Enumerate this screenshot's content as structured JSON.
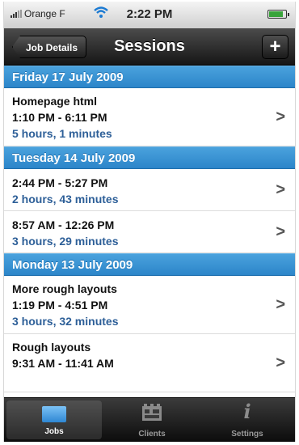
{
  "status_bar": {
    "carrier": "Orange F",
    "time": "2:22 PM"
  },
  "nav": {
    "back_label": "Job Details",
    "title": "Sessions",
    "add_label": "+"
  },
  "sections": [
    {
      "header": "Friday 17 July 2009",
      "rows": [
        {
          "title": "Homepage html",
          "times": "1:10 PM - 6:11 PM",
          "duration": "5 hours, 1 minutes"
        }
      ]
    },
    {
      "header": "Tuesday 14 July 2009",
      "rows": [
        {
          "times": "2:44 PM - 5:27 PM",
          "duration": "2 hours, 43 minutes"
        },
        {
          "times": "8:57 AM - 12:26 PM",
          "duration": "3 hours, 29 minutes"
        }
      ]
    },
    {
      "header": "Monday 13 July 2009",
      "rows": [
        {
          "title": "More rough layouts",
          "times": "1:19 PM - 4:51 PM",
          "duration": "3 hours, 32 minutes"
        },
        {
          "title": "Rough layouts",
          "times": "9:31 AM - 11:41 AM"
        }
      ]
    }
  ],
  "chevron": ">",
  "tabs": [
    {
      "label": "Jobs",
      "icon": "folder-icon"
    },
    {
      "label": "Clients",
      "icon": "film-icon"
    },
    {
      "label": "Settings",
      "icon": "info-icon"
    }
  ],
  "colors": {
    "section_header": "#3a93d4",
    "duration_text": "#2d5f98"
  }
}
